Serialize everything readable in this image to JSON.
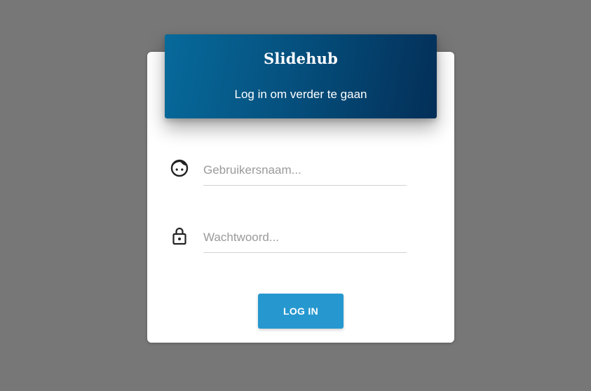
{
  "header": {
    "brand": "Slidehub",
    "subtitle": "Log in om verder te gaan"
  },
  "form": {
    "username": {
      "icon": "face-icon",
      "value": "",
      "placeholder": "Gebruikersnaam..."
    },
    "password": {
      "icon": "lock-icon",
      "value": "",
      "placeholder": "Wachtwoord..."
    },
    "submit_label": "LOG IN"
  },
  "colors": {
    "background": "#777777",
    "card": "#ffffff",
    "header_gradient_start": "#076a9b",
    "header_gradient_end": "#032f58",
    "button": "#2698cf",
    "input_underline": "#d2d2d2",
    "placeholder": "#9a9a9a"
  }
}
